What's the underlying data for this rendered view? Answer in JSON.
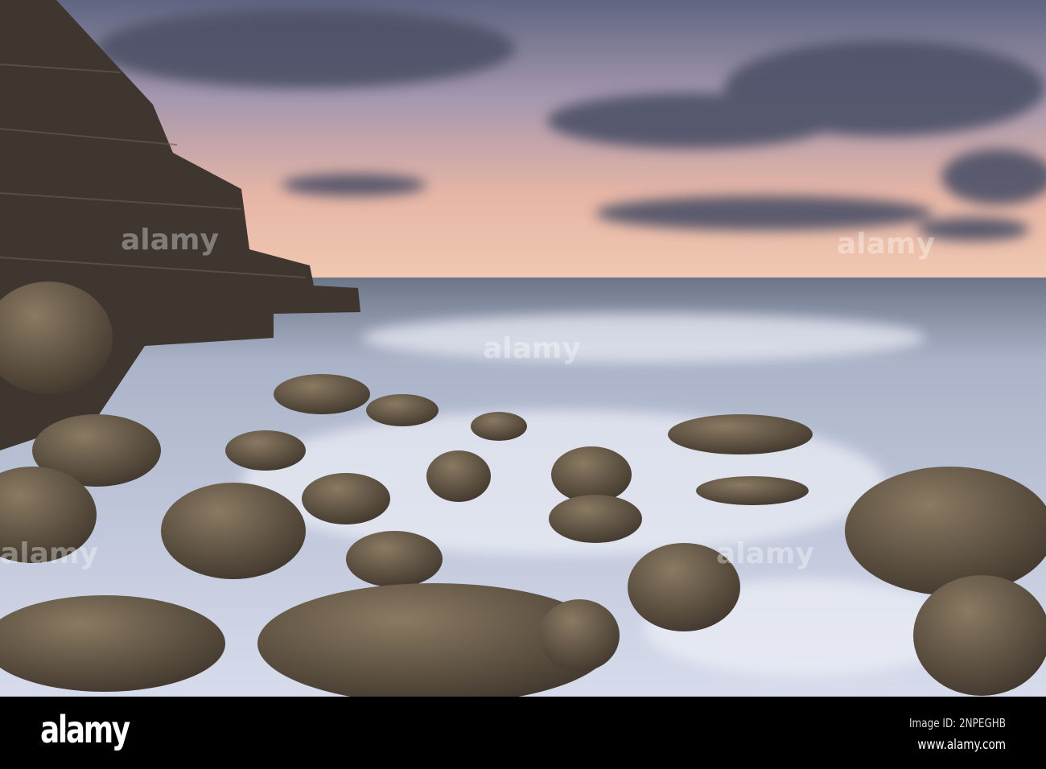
{
  "photo": {
    "subject": "rocky coastline at sunset with long-exposure sea",
    "watermark": "alamy",
    "colors": {
      "sky_top": "#6f7390",
      "sky_glow": "#e8b3a4",
      "sea": "#b9c2d8",
      "rock": "#5a4d3f",
      "cliff": "#3f3630"
    }
  },
  "footer": {
    "logo": "alamy",
    "image_id": "Image ID: 2NPEGHB",
    "url": "www.alamy.com"
  }
}
